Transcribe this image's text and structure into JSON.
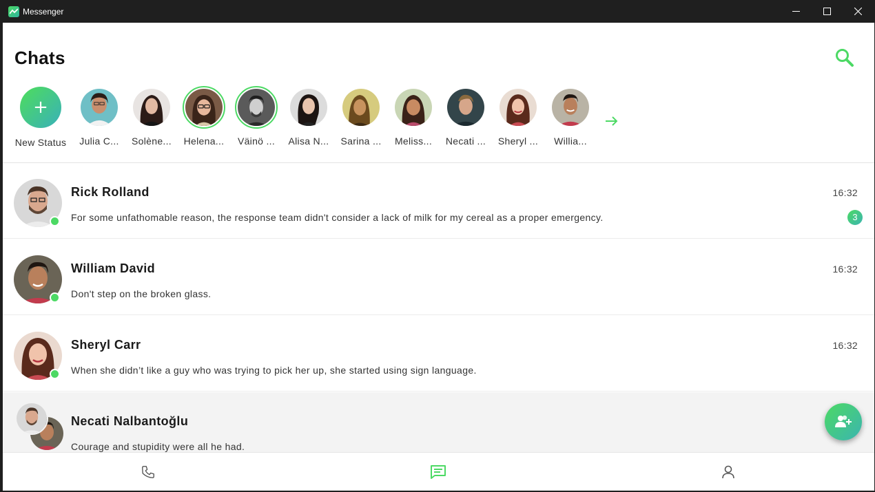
{
  "window": {
    "title": "Messenger",
    "icon": "messenger-app-icon"
  },
  "header": {
    "title": "Chats",
    "search_icon": "search-icon"
  },
  "statuses": {
    "new_status_label": "New Status",
    "items": [
      {
        "label": "Julia C...",
        "state": "seen"
      },
      {
        "label": "Solène...",
        "state": "seen"
      },
      {
        "label": "Helena...",
        "state": "new"
      },
      {
        "label": "Väinö ...",
        "state": "new"
      },
      {
        "label": "Alisa N...",
        "state": "seen"
      },
      {
        "label": "Sarina ...",
        "state": "seen"
      },
      {
        "label": "Meliss...",
        "state": "seen"
      },
      {
        "label": "Necati ...",
        "state": "seen"
      },
      {
        "label": "Sheryl ...",
        "state": "seen"
      },
      {
        "label": "Willia...",
        "state": "seen"
      }
    ],
    "more_icon": "arrow-right-icon"
  },
  "chats": [
    {
      "name": "Rick Rolland",
      "time": "16:32",
      "message": "For some unfathomable reason, the response team didn't consider a lack of milk for my cereal as a proper emergency.",
      "unread": "3",
      "online": true
    },
    {
      "name": "William David",
      "time": "16:32",
      "message": "Don't step on the broken glass.",
      "online": true
    },
    {
      "name": "Sheryl Carr",
      "time": "16:32",
      "message": "When she didn’t like a guy who was trying to pick her up, she started using sign language.",
      "online": true
    },
    {
      "name": "Necati Nalbantoğlu",
      "time": "",
      "message": "Courage and stupidity were all he had.",
      "group": true
    }
  ],
  "fab": {
    "icon": "add-contact-icon"
  },
  "nav": {
    "calls_icon": "phone-icon",
    "chats_icon": "chat-bubble-icon",
    "profile_icon": "user-icon"
  },
  "colors": {
    "accent": "#4cd964",
    "accent_teal": "#3bb5b0",
    "titlebar": "#1f1f1f"
  }
}
